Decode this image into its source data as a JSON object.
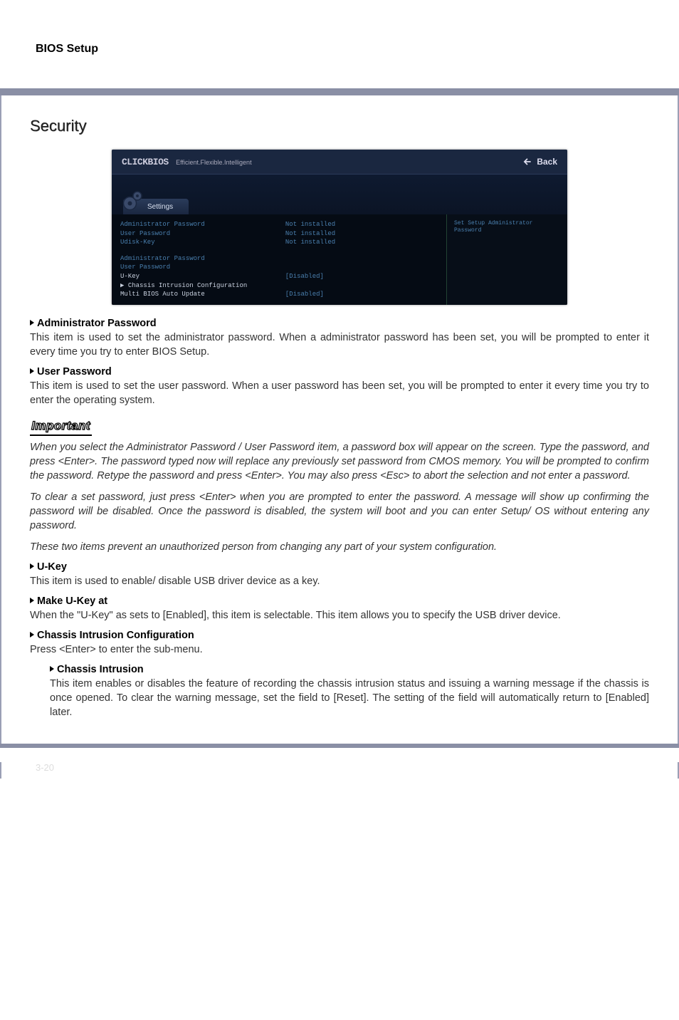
{
  "header": {
    "title": "BIOS Setup"
  },
  "section": {
    "title": "Security"
  },
  "bios": {
    "logo_text": "CLICKBIOS",
    "tagline": "Efficient.Flexible.Intelligent",
    "back_label": "Back",
    "tab_label": "Settings",
    "help_text": "Set Setup Administrator Password",
    "rows_top": [
      {
        "label": "Administrator Password",
        "value": "Not installed"
      },
      {
        "label": "User Password",
        "value": "Not installed"
      },
      {
        "label": "Udisk-Key",
        "value": "Not installed"
      }
    ],
    "rows_bottom": [
      {
        "label": "Administrator Password",
        "value": ""
      },
      {
        "label": "User Password",
        "value": ""
      },
      {
        "label": "U-Key",
        "value": "[Disabled]"
      },
      {
        "label": "▶ Chassis Intrusion Configuration",
        "value": ""
      },
      {
        "label": "Multi BIOS Auto Update",
        "value": "[Disabled]"
      }
    ]
  },
  "items": {
    "admin_pw": {
      "heading": "Administrator Password",
      "text": "This item is used to set the administrator password. When a administrator password has been set, you will be prompted to enter it every time you try to enter BIOS Setup."
    },
    "user_pw": {
      "heading": "User Password",
      "text": "This item is used to set the user password. When a user password has been set, you will be prompted to enter it every time you try to enter the operating system."
    },
    "ukey": {
      "heading": "U-Key",
      "text": "This item is used to enable/ disable USB driver device as a key."
    },
    "make_ukey": {
      "heading": "Make U-Key at",
      "text": "When the \"U-Key\" as sets to [Enabled], this item is selectable. This item allows you to specify the USB driver device."
    },
    "chassis_cfg": {
      "heading": "Chassis Intrusion Configuration",
      "text": "Press <Enter> to enter the sub-menu."
    },
    "chassis_intrusion": {
      "heading": "Chassis Intrusion",
      "text": "This item enables or disables the feature of recording the chassis intrusion status and issuing a warning message if the chassis is once opened. To clear the warning message, set the field to [Reset]. The setting of the field will automatically return to [Enabled] later."
    }
  },
  "important": {
    "label": "Important",
    "p1": "When you select the Administrator Password / User Password item, a password box will appear on the screen. Type the password, and press <Enter>. The password typed now will replace any previously set password from CMOS memory. You will be prompted to confirm the password. Retype the password and press <Enter>. You may also press <Esc> to abort the selection and not enter a password.",
    "p2": "To clear a set password, just press <Enter> when you are prompted to enter the password. A message will show up confirming the password will be disabled. Once the password is disabled, the system will boot and you can enter Setup/ OS without entering any password.",
    "p3": "These two items prevent an unauthorized person from changing any part of your system configuration."
  },
  "footer": {
    "page_number": "3-20"
  }
}
